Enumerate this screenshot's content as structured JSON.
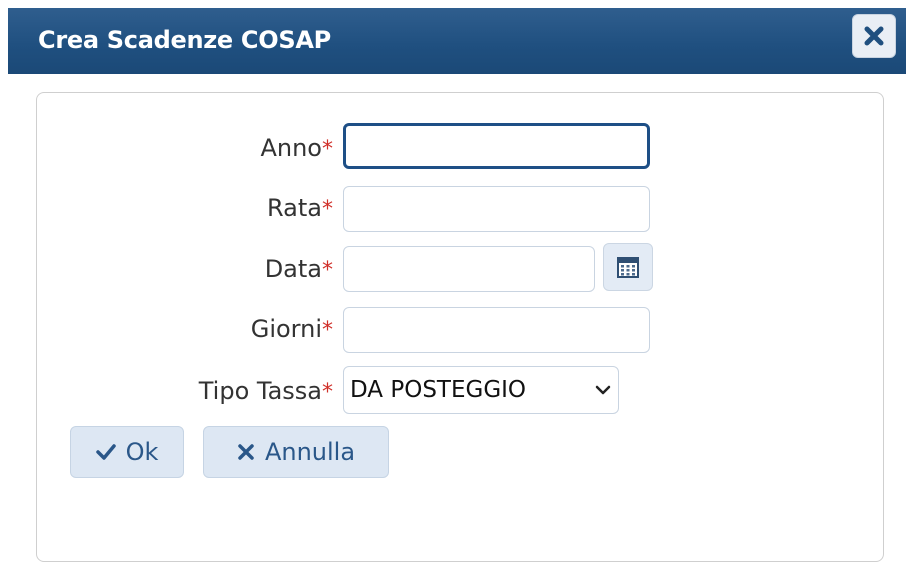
{
  "dialog": {
    "title": "Crea Scadenze COSAP",
    "close_icon": "close-icon"
  },
  "form": {
    "required_marker": "*",
    "fields": [
      {
        "label": "Anno",
        "value": "",
        "type": "text",
        "focused": true
      },
      {
        "label": "Rata",
        "value": "",
        "type": "text"
      },
      {
        "label": "Data",
        "value": "",
        "type": "date",
        "icon": "calendar-icon"
      },
      {
        "label": "Giorni",
        "value": "",
        "type": "text"
      },
      {
        "label": "Tipo Tassa",
        "value": "DA POSTEGGIO",
        "type": "select",
        "icon": "chevron-down-icon"
      }
    ]
  },
  "actions": {
    "ok": {
      "label": "Ok",
      "icon": "check-icon"
    },
    "cancel": {
      "label": "Annulla",
      "icon": "x-icon"
    }
  },
  "colors": {
    "titlebar": "#1f4f7f",
    "required": "#d0302a",
    "button_bg": "#dde7f3",
    "button_text": "#2a5789",
    "focus_border": "#1e4f86"
  }
}
